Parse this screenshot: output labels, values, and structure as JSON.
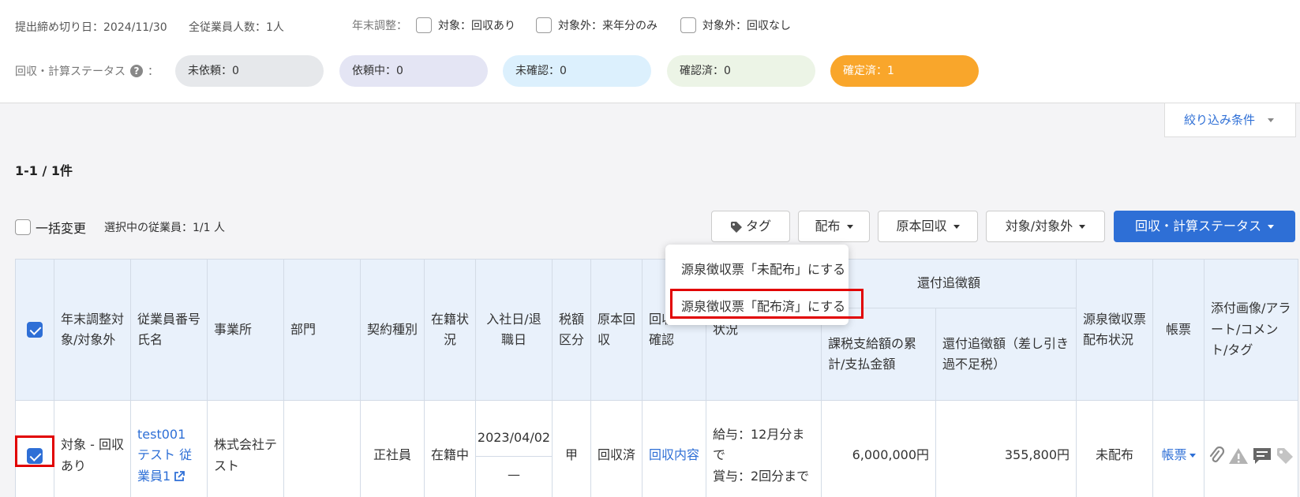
{
  "header": {
    "deadline": "提出締め切り日：2024/11/30",
    "employee_count": "全従業員人数：1人",
    "year_end_label": "年末調整：",
    "year_end_options": [
      "対象：回収あり",
      "対象外：来年分のみ",
      "対象外：回収なし"
    ],
    "status_label": "回収・計算ステータス",
    "status_colon": "：",
    "help_icon": "?",
    "status_pills": [
      {
        "label": "未依頼：0",
        "bg": "#e6e8eb",
        "fg": "#333333"
      },
      {
        "label": "依頼中：0",
        "bg": "#e4e5f4",
        "fg": "#333333"
      },
      {
        "label": "未確認：0",
        "bg": "#dcf0fd",
        "fg": "#333333"
      },
      {
        "label": "確認済：0",
        "bg": "#ecf4e6",
        "fg": "#333333"
      },
      {
        "label": "確定済：1",
        "bg": "#f9a62b",
        "fg": "#ffffff"
      }
    ]
  },
  "filter_button": "絞り込み条件",
  "result_count": "1-1 / 1件",
  "toolbar": {
    "bulk_change": "一括変更",
    "selected": "選択中の従業員：1/1 人",
    "tag": "タグ",
    "distribute": "配布",
    "original_collect": "原本回収",
    "target_toggle": "対象/対象外",
    "status": "回収・計算ステータス"
  },
  "dropdown": {
    "items": [
      "源泉徴収票「未配布」にする",
      "源泉徴収票「配布済」にする"
    ]
  },
  "table": {
    "headers": {
      "year_end": "年末調整対象/対象外",
      "emp_no": "従業員番号",
      "emp_name": "氏名",
      "office": "事業所",
      "dept": "部門",
      "contract": "契約種別",
      "enrolled": "在籍状況",
      "hire_date": "入社日/退職日",
      "tax_class": "税額区分",
      "original": "原本回収",
      "content_check": "回収内容確認",
      "status": "状況",
      "refund_group": "還付追徴額",
      "taxable_total": "課税支給額の累計/支払金額",
      "refund_amount": "還付追徴額（差し引き過不足税）",
      "withholding": "源泉徴収票配布状況",
      "forms": "帳票",
      "attachments": "添付画像/アラート/コメント/タグ"
    },
    "row": {
      "year_end": "対象 - 回収あり",
      "emp_no": "test001",
      "emp_name": "テスト 従業員1",
      "office": "株式会社テスト",
      "dept": "",
      "contract": "正社員",
      "enrolled": "在籍中",
      "hire_date": "2023/04/02",
      "leave_date": "—",
      "tax_class": "甲",
      "original": "回収済",
      "content_check": "回収内容",
      "status_salary": "給与：12月分まで",
      "status_bonus": "賞与：2回分まで",
      "taxable_total": "6,000,000円",
      "refund_amount": "355,800円",
      "withholding": "未配布",
      "forms": "帳票"
    }
  },
  "icons": [
    "help-icon",
    "tag-icon",
    "external-link-icon",
    "paperclip-icon",
    "alert-icon",
    "comment-icon",
    "tag-icon"
  ],
  "colors": {
    "primary": "#2e6fd6",
    "highlight": "#e10000",
    "confirmed": "#f9a62b"
  }
}
